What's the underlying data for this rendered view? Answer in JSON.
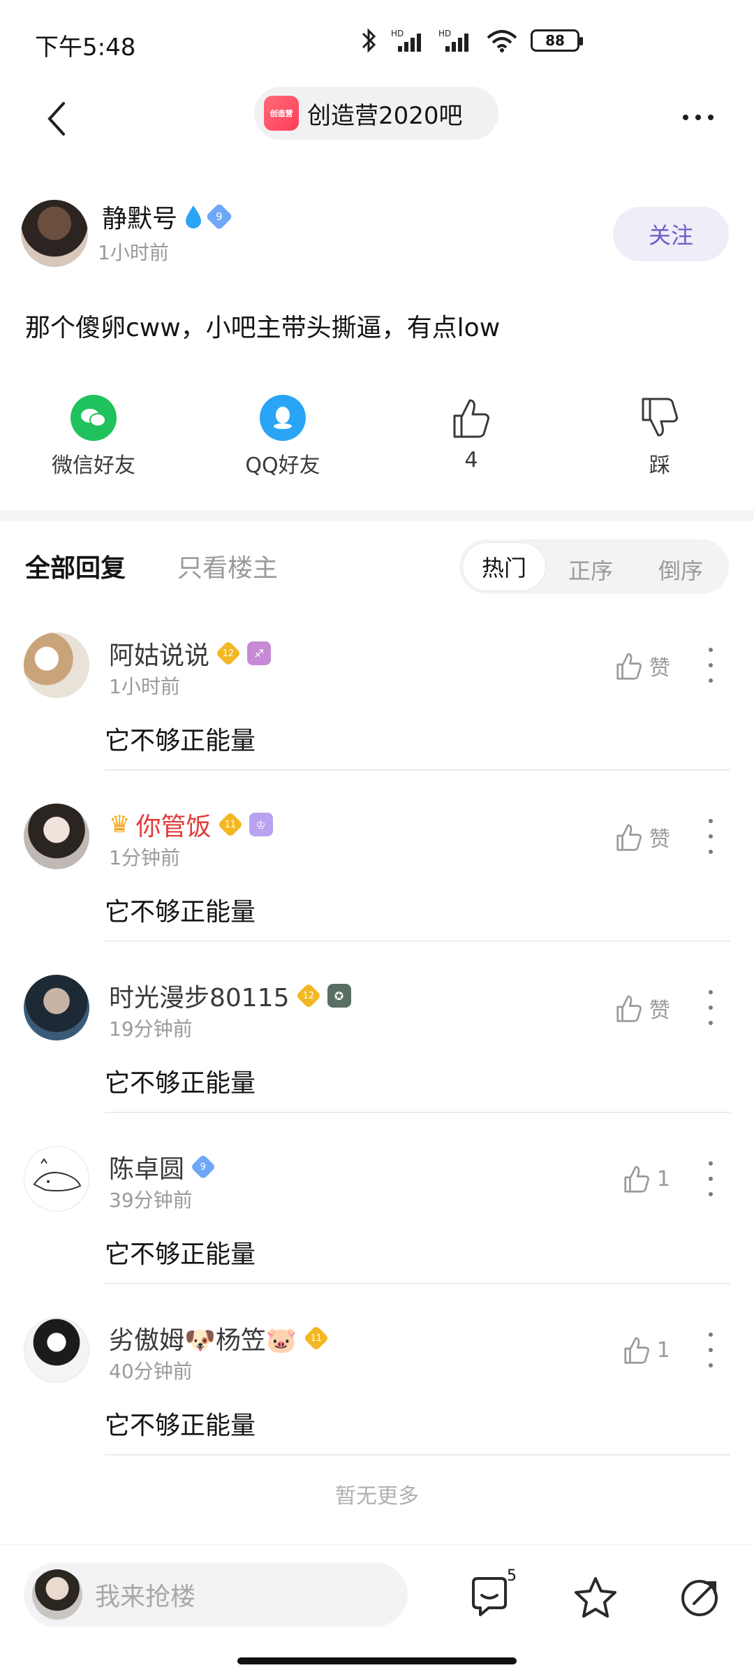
{
  "status_bar": {
    "time": "下午5:48",
    "battery": "88"
  },
  "nav": {
    "forum_name": "创造营2020吧",
    "forum_logo_text": "创造营"
  },
  "post": {
    "author_name": "静默号",
    "author_level": "9",
    "author_time": "1小时前",
    "follow_label": "关注",
    "content": "那个傻卵cww，小吧主带头撕逼，有点low"
  },
  "share": {
    "wechat_label": "微信好友",
    "qq_label": "QQ好友",
    "like_count": "4",
    "dislike_label": "踩"
  },
  "tabs": {
    "all_label": "全部回复",
    "owner_label": "只看楼主",
    "sort_hot": "热门",
    "sort_asc": "正序",
    "sort_desc": "倒序"
  },
  "comments": [
    {
      "name": "阿姑说说",
      "level": "12",
      "time": "1小时前",
      "text": "它不够正能量",
      "like": "赞"
    },
    {
      "name": "你管饭",
      "level": "11",
      "time": "1分钟前",
      "text": "它不够正能量",
      "like": "赞"
    },
    {
      "name": "时光漫步80115",
      "level": "12",
      "time": "19分钟前",
      "text": "它不够正能量",
      "like": "赞"
    },
    {
      "name": "陈卓圆",
      "level": "9",
      "time": "39分钟前",
      "text": "它不够正能量",
      "like": "1"
    },
    {
      "name": "劣傲姆🐶杨笠🐷",
      "level": "11",
      "time": "40分钟前",
      "text": "它不够正能量",
      "like": "1"
    }
  ],
  "no_more": "暂无更多",
  "bottom": {
    "reply_placeholder": "我来抢楼",
    "reply_count": "5"
  },
  "colors": {
    "accent_purple": "#6c5ec7",
    "wechat_green": "#1fc25c",
    "qq_blue": "#2aa4f4",
    "level_gold": "#f2b722",
    "level_blue": "#6ea7f7",
    "vip_red": "#e23a3a"
  }
}
